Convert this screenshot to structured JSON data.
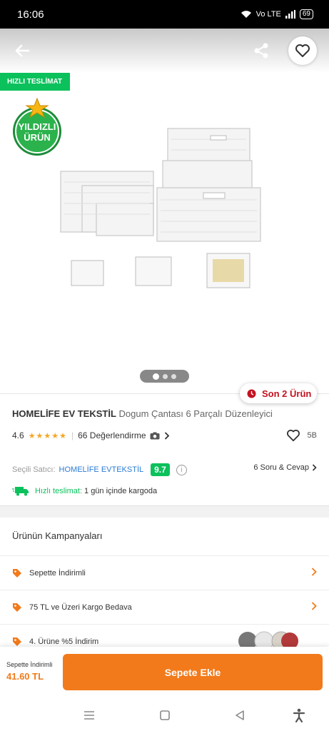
{
  "status_bar": {
    "time": "16:06",
    "network": "Vo LTE",
    "battery": "69"
  },
  "image_area": {
    "fast_delivery_badge": "HIZLI TESLİMAT",
    "logo_text_top": "YILDIZLI",
    "logo_text_bottom": "ÜRÜN",
    "carousel_pages": 3,
    "carousel_active": 1
  },
  "stock": {
    "label": "Son 2 Ürün"
  },
  "product": {
    "brand": "HOMELİFE EV TEKSTİL",
    "name": "Dogum Çantası 6 Parçalı Düzenleyici",
    "rating": "4.6",
    "stars": "★★★★★",
    "reviews": "66 Değerlendirme",
    "favorites": "5B"
  },
  "seller": {
    "label": "Seçili Satıcı:",
    "name": "HOMELİFE EVTEKSTİL",
    "score": "9.7",
    "qa": "6 Soru & Cevap"
  },
  "delivery": {
    "fast": "Hızlı teslimat:",
    "text": "1 gün içinde kargoda"
  },
  "campaigns": {
    "title": "Ürünün Kampanyaları",
    "items": [
      {
        "label": "Sepette İndirimli"
      },
      {
        "label": "75 TL ve Üzeri Kargo Bedava"
      },
      {
        "label": "4. Ürüne %5 İndirim"
      }
    ]
  },
  "cart": {
    "price_label": "Sepette İndirimli",
    "price": "41.60 TL",
    "button": "Sepete Ekle"
  },
  "colors": {
    "orange": "#f27a1a",
    "green": "#0bc15c",
    "red": "#c4121f",
    "blue": "#2b7bd6"
  }
}
